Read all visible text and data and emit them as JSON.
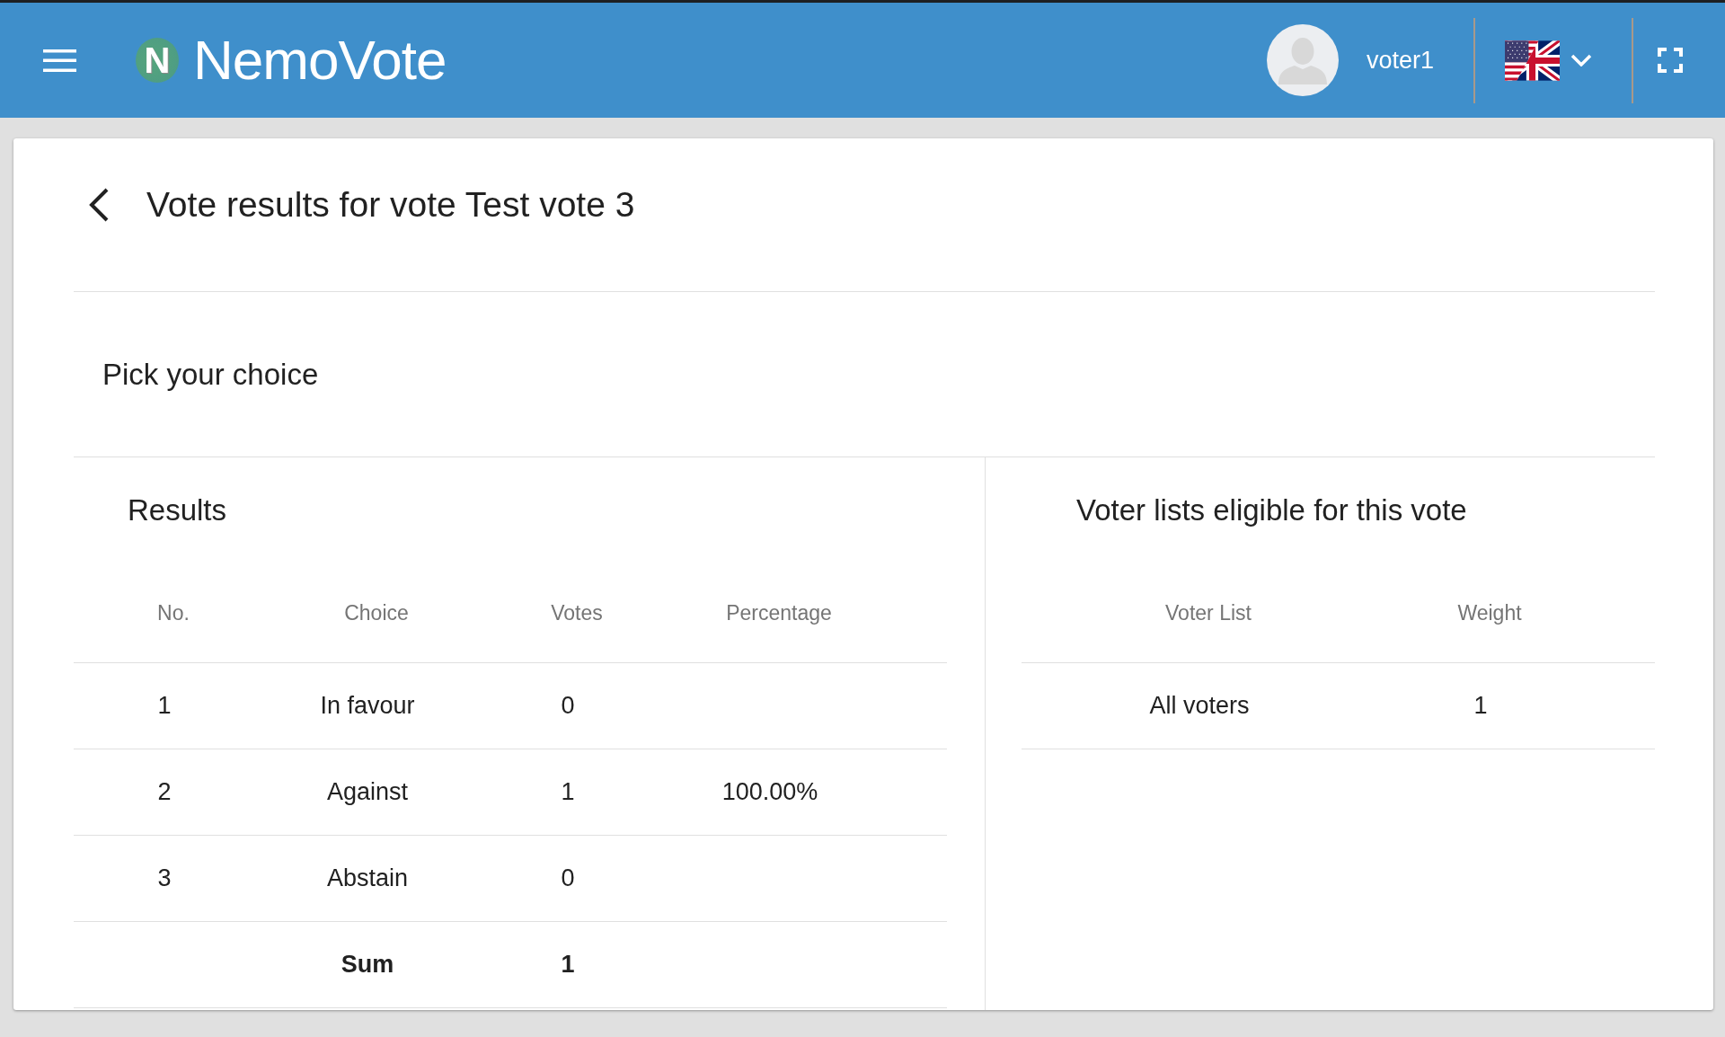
{
  "header": {
    "logo": {
      "mark": "N",
      "name": "NemoVote"
    },
    "user": {
      "name": "voter1"
    }
  },
  "page": {
    "title": "Vote results for vote Test vote 3",
    "question": "Pick your choice"
  },
  "results": {
    "title": "Results",
    "columns": [
      "No.",
      "Choice",
      "Votes",
      "Percentage"
    ],
    "rows": [
      {
        "no": "1",
        "choice": "In favour",
        "votes": "0"
      },
      {
        "no": "2",
        "choice": "Against",
        "votes": "1",
        "percentage": "100.00%"
      },
      {
        "no": "3",
        "choice": "Abstain",
        "votes": "0"
      }
    ],
    "total": {
      "label": "Sum",
      "votes": "1"
    }
  },
  "voter_lists": {
    "title": "Voter lists eligible for this vote",
    "columns": [
      "Voter List",
      "Weight"
    ],
    "rows": [
      {
        "voter_list": "All voters",
        "weight": "1"
      }
    ]
  }
}
